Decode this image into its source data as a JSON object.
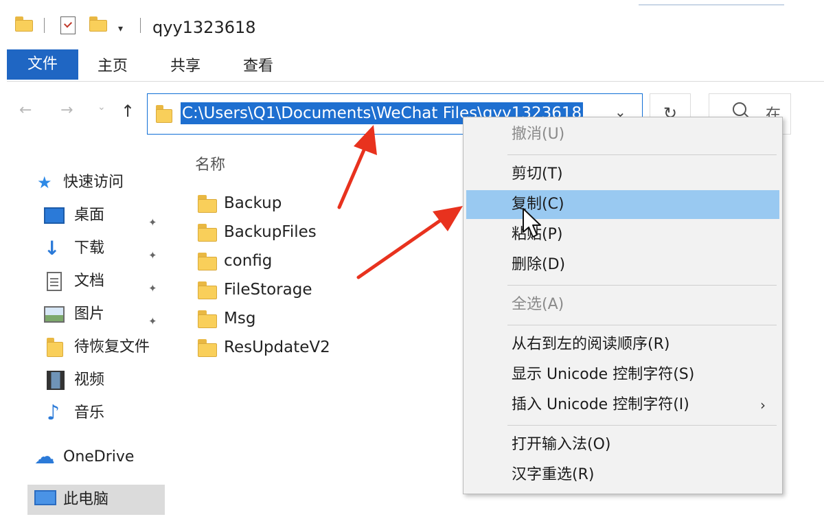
{
  "window": {
    "title": "qyy1323618",
    "qat_dropdown": "▾"
  },
  "ribbon": {
    "tabs": [
      "文件",
      "主页",
      "共享",
      "查看"
    ]
  },
  "address_bar": {
    "path": "C:\\Users\\Q1\\Documents\\WeChat Files\\qyy1323618",
    "chevron": "⌄",
    "refresh": "↻",
    "search_placeholder": "在"
  },
  "nav_buttons": {
    "back": "←",
    "forward": "→",
    "recent": "⌄",
    "up": "↑"
  },
  "sidebar": {
    "quick_access": "快速访问",
    "items": [
      {
        "label": "桌面",
        "icon": "desktop-icon",
        "pinned": true
      },
      {
        "label": "下载",
        "icon": "download-icon",
        "pinned": true
      },
      {
        "label": "文档",
        "icon": "document-icon",
        "pinned": true
      },
      {
        "label": "图片",
        "icon": "pictures-icon",
        "pinned": true
      },
      {
        "label": "待恢复文件",
        "icon": "folder-icon",
        "pinned": false
      },
      {
        "label": "视频",
        "icon": "video-icon",
        "pinned": false
      },
      {
        "label": "音乐",
        "icon": "music-icon",
        "pinned": false
      }
    ],
    "onedrive": "OneDrive",
    "this_pc": "此电脑"
  },
  "content": {
    "column_name": "名称",
    "files": [
      "Backup",
      "BackupFiles",
      "config",
      "FileStorage",
      "Msg",
      "ResUpdateV2"
    ]
  },
  "context_menu": {
    "items": [
      {
        "label": "撤消(U)",
        "disabled": true
      },
      {
        "label": "剪切(T)",
        "disabled": false
      },
      {
        "label": "复制(C)",
        "disabled": false,
        "highlighted": true
      },
      {
        "label": "粘贴(P)",
        "disabled": false
      },
      {
        "label": "删除(D)",
        "disabled": false
      },
      {
        "label": "全选(A)",
        "disabled": true
      },
      {
        "label": "从右到左的阅读顺序(R)",
        "disabled": false
      },
      {
        "label": "显示 Unicode 控制字符(S)",
        "disabled": false
      },
      {
        "label": "插入 Unicode 控制字符(I)",
        "disabled": false,
        "submenu": true
      },
      {
        "label": "打开输入法(O)",
        "disabled": false
      },
      {
        "label": "汉字重选(R)",
        "disabled": false
      }
    ],
    "submenu_arrow": "›"
  },
  "colors": {
    "accent": "#1f66c3",
    "selection": "#1e6fd0",
    "menu_hover": "#99c9f1",
    "annotation_arrow": "#e8321e"
  },
  "pin_glyph": "📌"
}
